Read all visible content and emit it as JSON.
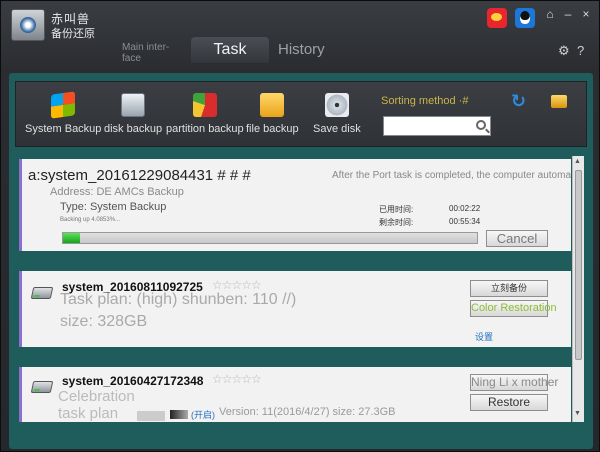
{
  "app": {
    "brand_line1": "赤叫兽",
    "brand_line2": "备份还原",
    "tab_main": "Main inter-face",
    "tab_task": "Task",
    "tab_history": "History",
    "minimize": "–",
    "close": "×",
    "shirt": "⌂"
  },
  "toolbar": {
    "system_backup": "System Backup",
    "disk_backup": "disk backup",
    "partition_backup": "partition backup",
    "file_backup": "file backup",
    "save_disk": "Save disk",
    "sorting": "Sorting method ·#",
    "search_placeholder": ""
  },
  "tasks": {
    "t1": {
      "title": "a:system_20161229084431 # # #",
      "note": "After the Port task is completed, the computer automatically",
      "address": "Address: DE AMCs Backup",
      "type": "Type: System Backup",
      "progress_text": "Backing up 4.0853%...",
      "elapsed_label": "已用时间:",
      "elapsed": "00:02:22",
      "remaining_label": "剩余时间:",
      "remaining": "00:55:34",
      "progress": 0.04,
      "cancel": "Cancel"
    },
    "t2": {
      "title": "system_20160811092725",
      "stars": "☆☆☆☆☆",
      "plan": "Task plan: (high) shunben: 110 //)",
      "size": "size: 328GB",
      "backup_btn": "立刻备份",
      "restore_btn": "Color Restoration",
      "settings": "设置"
    },
    "t3": {
      "title": "system_20160427172348",
      "stars": "☆☆☆☆☆",
      "plan1": "Celebration",
      "plan2": "task plan",
      "open": "(开启)",
      "info": "Version: 11(2016/4/27) size: 27.3GB",
      "btn1": "Ning Li x mother",
      "restore": "Restore"
    }
  }
}
